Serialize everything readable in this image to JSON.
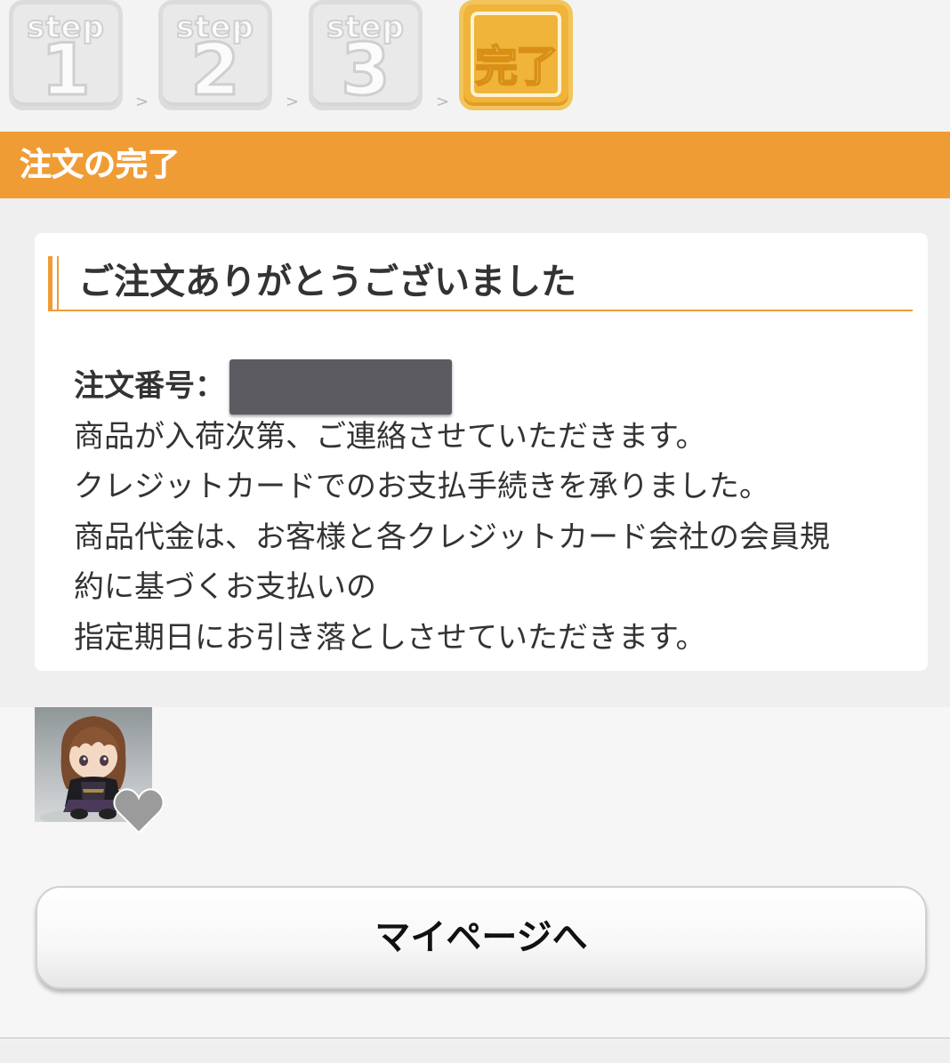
{
  "steps": [
    {
      "word": "step",
      "num": "1",
      "state": "inactive"
    },
    {
      "word": "step",
      "num": "2",
      "state": "inactive"
    },
    {
      "word": "step",
      "num": "3",
      "state": "inactive"
    },
    {
      "label": "完了",
      "state": "active"
    }
  ],
  "step_separator": ">",
  "header": {
    "title": "注文の完了"
  },
  "card": {
    "title": "ご注文ありがとうございました",
    "order_number_label": "注文番号：",
    "lines": [
      "商品が入荷次第、ご連絡させていただきます。",
      "クレジットカードでのお支払手続きを承りました。",
      "商品代金は、お客様と各クレジットカード会社の会員規",
      "約に基づくお支払いの",
      "指定期日にお引き落としさせていただきます。"
    ]
  },
  "colors": {
    "accent": "#f09c35",
    "step_active": "#f0b43a",
    "redaction": "#5b5b61"
  },
  "button": {
    "label": "マイページへ"
  }
}
